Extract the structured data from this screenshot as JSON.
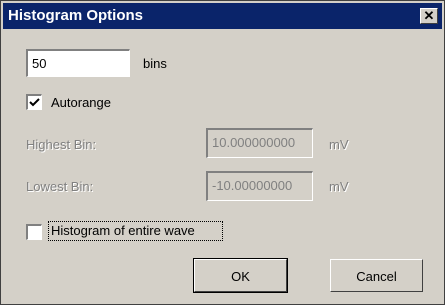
{
  "window": {
    "title": "Histogram Options",
    "close_glyph": "✕"
  },
  "bins": {
    "value": "50",
    "label": "bins"
  },
  "autorange": {
    "label": "Autorange",
    "checked": true
  },
  "highest_bin": {
    "label": "Highest Bin:",
    "value": "10.000000000",
    "unit": "mV",
    "enabled": false
  },
  "lowest_bin": {
    "label": "Lowest Bin:",
    "value": "-10.00000000",
    "unit": "mV",
    "enabled": false
  },
  "entire_wave": {
    "label": "Histogram of entire wave",
    "checked": false
  },
  "buttons": {
    "ok_label": "OK",
    "cancel_label": "Cancel"
  },
  "colors": {
    "titlebar": "#0a246a",
    "face": "#d4d0c8",
    "disabled_text": "#808080"
  }
}
